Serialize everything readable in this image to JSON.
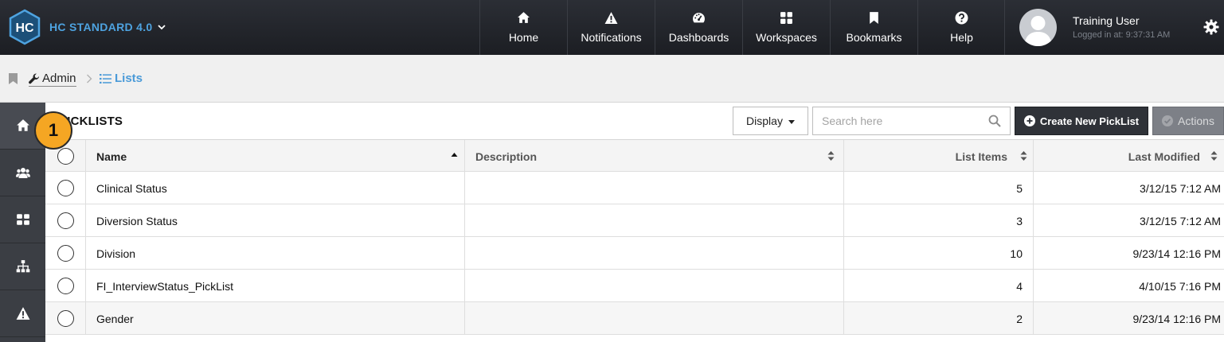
{
  "app": {
    "logo_text": "HC",
    "title": "HC STANDARD 4.0"
  },
  "nav": [
    {
      "id": "home",
      "label": "Home",
      "icon": "home-icon"
    },
    {
      "id": "notifications",
      "label": "Notifications",
      "icon": "warning-icon"
    },
    {
      "id": "dashboards",
      "label": "Dashboards",
      "icon": "gauge-icon"
    },
    {
      "id": "workspaces",
      "label": "Workspaces",
      "icon": "grid-icon"
    },
    {
      "id": "bookmarks",
      "label": "Bookmarks",
      "icon": "bookmark-icon"
    },
    {
      "id": "help",
      "label": "Help",
      "icon": "question-circle-icon"
    }
  ],
  "user": {
    "name": "Training User",
    "status": "Logged in at: 9:37:31 AM"
  },
  "breadcrumb": {
    "admin": "Admin",
    "current": "Lists"
  },
  "sidebar": [
    "home-icon",
    "users-icon",
    "grid-icon",
    "sitemap-icon",
    "warning-icon"
  ],
  "page": {
    "title": "PICKLISTS",
    "step_badge": "1"
  },
  "toolbar": {
    "display_label": "Display",
    "search_placeholder": "Search here",
    "create_label": "Create New PickList",
    "actions_label": "Actions"
  },
  "table": {
    "columns": {
      "name": "Name",
      "description": "Description",
      "list_items": "List Items",
      "last_modified": "Last Modified"
    },
    "rows": [
      {
        "name": "Clinical Status",
        "description": "",
        "list_items": "5",
        "last_modified": "3/12/15 7:12 AM"
      },
      {
        "name": "Diversion Status",
        "description": "",
        "list_items": "3",
        "last_modified": "3/12/15 7:12 AM"
      },
      {
        "name": "Division",
        "description": "",
        "list_items": "10",
        "last_modified": "9/23/14 12:16 PM"
      },
      {
        "name": "FI_InterviewStatus_PickList",
        "description": "",
        "list_items": "4",
        "last_modified": "4/10/15 7:16 PM"
      },
      {
        "name": "Gender",
        "description": "",
        "list_items": "2",
        "last_modified": "9/23/14 12:16 PM"
      }
    ]
  },
  "colors": {
    "topbar": "#22252a",
    "accent_blue": "#4a9ad8",
    "badge_orange": "#f5a623",
    "sidebar": "#3b3e44"
  }
}
